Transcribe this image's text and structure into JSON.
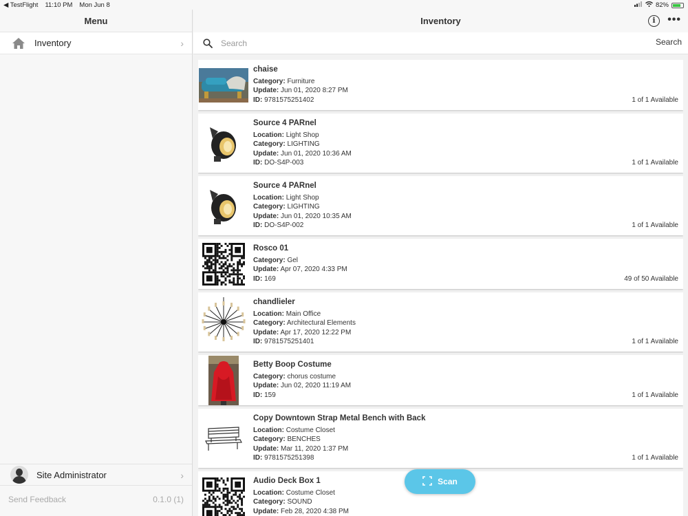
{
  "statusbar": {
    "carrier": "◀ TestFlight",
    "time": "11:10 PM",
    "date": "Mon Jun 8",
    "battery": "82%",
    "battery_level": 0.82
  },
  "sidebar": {
    "title": "Menu",
    "items": [
      {
        "label": "Inventory",
        "icon": "home-icon"
      }
    ],
    "user": {
      "label": "Site Administrator",
      "icon": "avatar"
    },
    "feedback": "Send Feedback",
    "version": "0.1.0 (1)"
  },
  "main": {
    "title": "Inventory",
    "search": {
      "placeholder": "Search",
      "button": "Search"
    },
    "items": [
      {
        "name": "chaise",
        "fields": [
          {
            "k": "Category:",
            "v": " Furniture"
          },
          {
            "k": "Update:",
            "v": " Jun 01, 2020 8:27 PM"
          },
          {
            "k": "ID:",
            "v": " 9781575251402"
          }
        ],
        "available": "1 of 1 Available",
        "thumb": "chaise-photo"
      },
      {
        "name": "Source 4 PARnel",
        "fields": [
          {
            "k": "Location:",
            "v": " Light Shop"
          },
          {
            "k": "Category:",
            "v": " LIGHTING"
          },
          {
            "k": "Update:",
            "v": " Jun 01, 2020 10:36 AM"
          },
          {
            "k": "ID:",
            "v": " DO-S4P-003"
          }
        ],
        "available": "1 of 1 Available",
        "thumb": "spotlight-photo"
      },
      {
        "name": "Source 4 PARnel",
        "fields": [
          {
            "k": "Location:",
            "v": " Light Shop"
          },
          {
            "k": "Category:",
            "v": " LIGHTING"
          },
          {
            "k": "Update:",
            "v": " Jun 01, 2020 10:35 AM"
          },
          {
            "k": "ID:",
            "v": " DO-S4P-002"
          }
        ],
        "available": "1 of 1 Available",
        "thumb": "spotlight-photo"
      },
      {
        "name": "Rosco 01",
        "fields": [
          {
            "k": "Category:",
            "v": " Gel"
          },
          {
            "k": "Update:",
            "v": " Apr 07, 2020 4:33 PM"
          },
          {
            "k": "ID:",
            "v": " 169"
          }
        ],
        "available": "49 of 50 Available",
        "thumb": "qr-code"
      },
      {
        "name": "chandlieler",
        "fields": [
          {
            "k": "Location:",
            "v": " Main Office"
          },
          {
            "k": "Category:",
            "v": " Architectural Elements"
          },
          {
            "k": "Update:",
            "v": " Apr 17, 2020 12:22 PM"
          },
          {
            "k": "ID:",
            "v": " 9781575251401"
          }
        ],
        "available": "1 of 1 Available",
        "thumb": "chandelier-photo"
      },
      {
        "name": "Betty Boop Costume",
        "fields": [
          {
            "k": "Category:",
            "v": " chorus costume"
          },
          {
            "k": "Update:",
            "v": " Jun 02, 2020 11:19 AM"
          },
          {
            "k": "ID:",
            "v": " 159"
          }
        ],
        "available": "1 of 1 Available",
        "thumb": "costume-photo"
      },
      {
        "name": "Copy Downtown Strap Metal Bench with Back",
        "fields": [
          {
            "k": "Location:",
            "v": " Costume Closet"
          },
          {
            "k": "Category:",
            "v": " BENCHES"
          },
          {
            "k": "Update:",
            "v": " Mar 11, 2020 1:37 PM"
          },
          {
            "k": "ID:",
            "v": " 9781575251398"
          }
        ],
        "available": "1 of 1 Available",
        "thumb": "bench-photo"
      },
      {
        "name": "Audio Deck Box 1",
        "fields": [
          {
            "k": "Location:",
            "v": " Costume Closet"
          },
          {
            "k": "Category:",
            "v": " SOUND"
          },
          {
            "k": "Update:",
            "v": " Feb 28, 2020 4:38 PM"
          }
        ],
        "available": "",
        "thumb": "qr-code"
      }
    ],
    "scan_button": "Scan"
  },
  "colors": {
    "scan_button": "#5bc6e8",
    "battery_fill": "#37c440"
  }
}
